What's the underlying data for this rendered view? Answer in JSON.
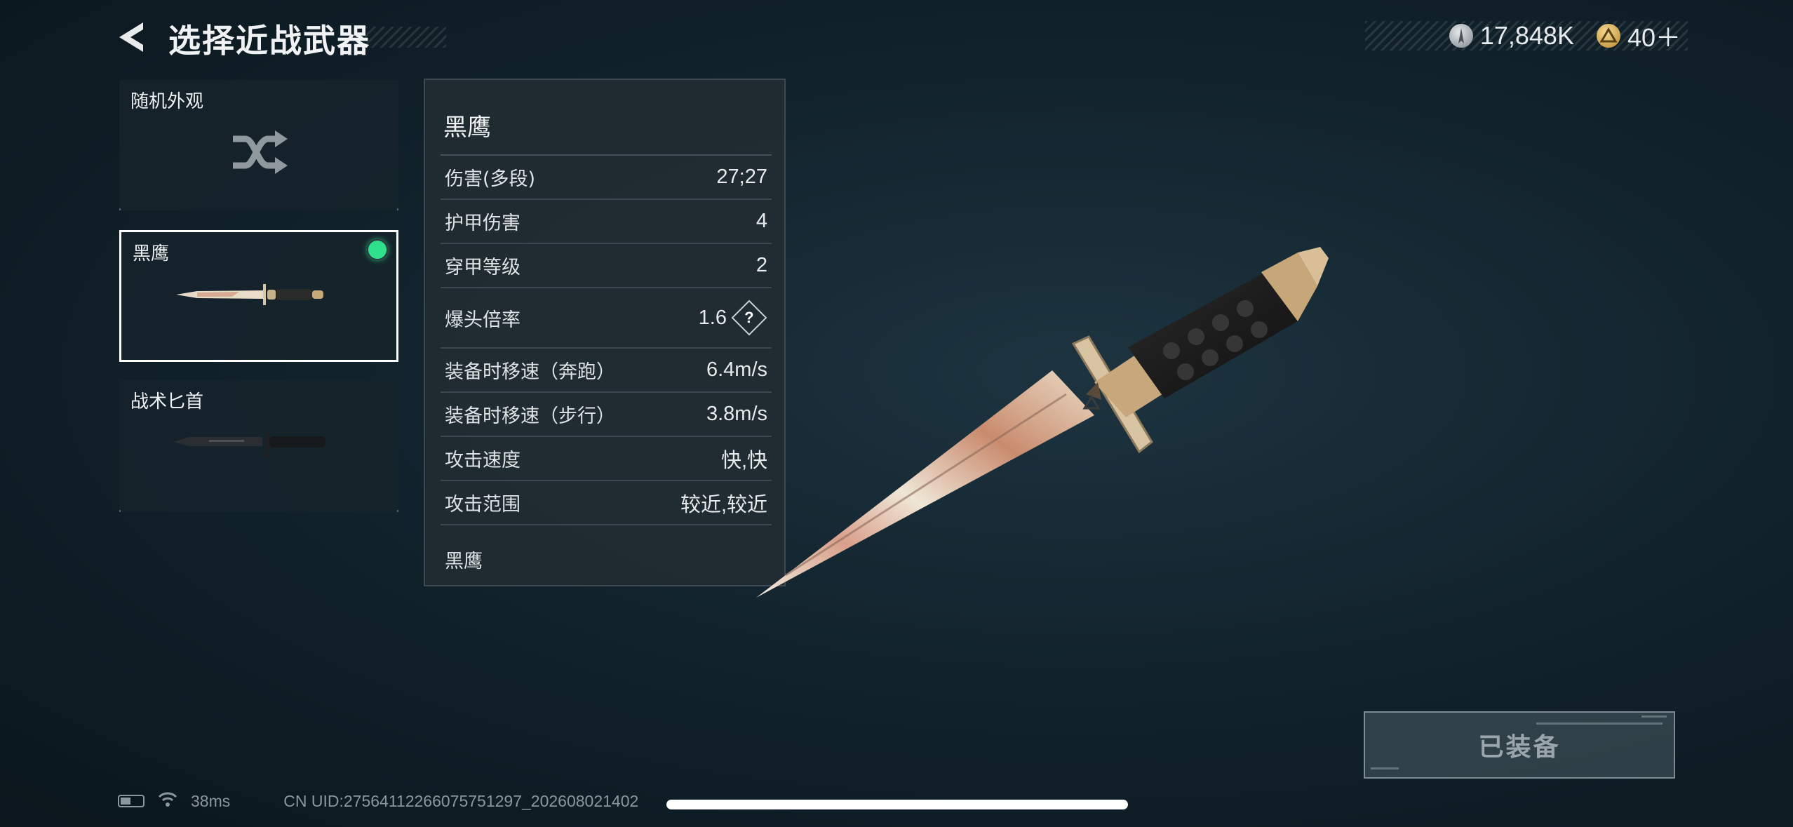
{
  "header": {
    "title": "选择近战武器",
    "silver_amount": "17,848K",
    "gold_amount": "40＋",
    "silver_icon": "silver-coin-icon",
    "gold_icon": "gold-coin-icon"
  },
  "weapons": [
    {
      "label": "随机外观",
      "icon": "shuffle-icon"
    },
    {
      "label": "黑鹰",
      "equipped": true
    },
    {
      "label": "战术匕首"
    }
  ],
  "stats": {
    "name": "黑鹰",
    "rows": [
      {
        "label": "伤害(多段)",
        "value": "27;27"
      },
      {
        "label": "护甲伤害",
        "value": "4"
      },
      {
        "label": "穿甲等级",
        "value": "2"
      },
      {
        "label": "爆头倍率",
        "value": "1.6",
        "help": "?"
      },
      {
        "label": "装备时移速（奔跑）",
        "value": "6.4m/s"
      },
      {
        "label": "装备时移速（步行）",
        "value": "3.8m/s"
      },
      {
        "label": "攻击速度",
        "value": "快,快"
      },
      {
        "label": "攻击范围",
        "value": "较近,较近"
      }
    ],
    "description": "黑鹰"
  },
  "equip_button": "已装备",
  "status_bar": {
    "ping": "38ms",
    "uid": "CN UID:2756411226607575129​7_202608021402"
  },
  "colors": {
    "equipped_dot": "#2fe28a",
    "selected_border": "#ffffff",
    "background": "#12232d"
  }
}
